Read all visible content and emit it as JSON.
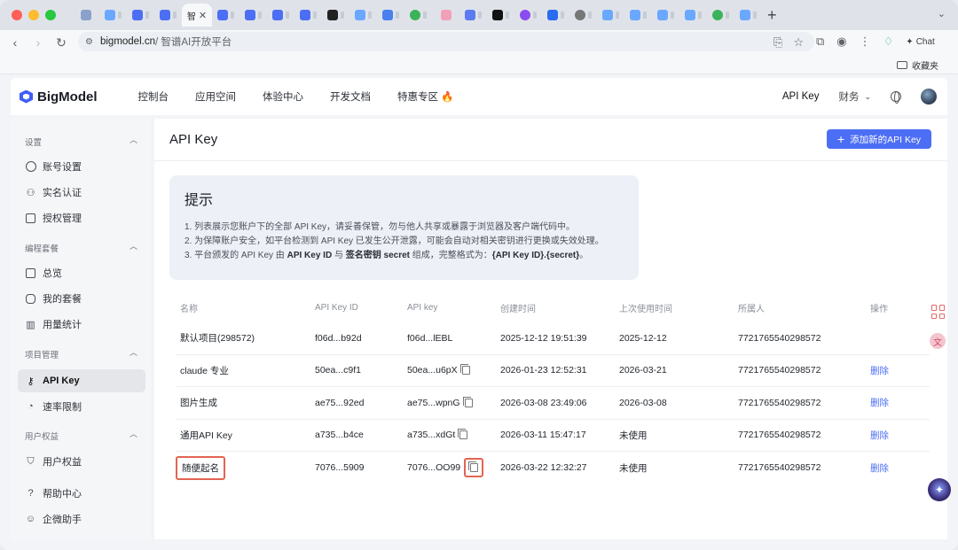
{
  "browser": {
    "active_tab_label": "智",
    "url_host": "bigmodel.cn",
    "url_rest": " / 智谱AI开放平台",
    "chat_label": "Chat",
    "bookmark_folder": "收藏夹"
  },
  "header": {
    "brand": "BigModel",
    "nav": [
      "控制台",
      "应用空间",
      "体验中心",
      "开发文档",
      "特惠专区 🔥"
    ],
    "api_key_link": "API Key",
    "finance_label": "财务"
  },
  "sidebar": {
    "sections": [
      {
        "title": "设置",
        "items": [
          "账号设置",
          "实名认证",
          "授权管理"
        ]
      },
      {
        "title": "编程套餐",
        "items": [
          "总览",
          "我的套餐",
          "用量统计"
        ]
      },
      {
        "title": "项目管理",
        "items": [
          "API Key",
          "速率限制"
        ]
      },
      {
        "title": "用户权益",
        "items": [
          "用户权益"
        ]
      }
    ],
    "footer_items": [
      "帮助中心",
      "企微助手"
    ]
  },
  "content": {
    "title": "API Key",
    "add_button": "添加新的API Key",
    "tip": {
      "title": "提示",
      "line1": "1. 列表展示您账户下的全部 API Key，请妥善保管，勿与他人共享或暴露于浏览器及客户端代码中。",
      "line2": "2. 为保障账户安全，如平台检测到 API Key 已发生公开泄露，可能会自动对相关密钥进行更换或失效处理。",
      "line3_a": "3. 平台颁发的 API Key 由 ",
      "line3_b": "API Key ID",
      "line3_c": " 与 ",
      "line3_d": "签名密钥 secret",
      "line3_e": " 组成，完整格式为：",
      "line3_f": "{API Key ID}.{secret}",
      "line3_g": "。"
    },
    "table": {
      "headers": [
        "名称",
        "API Key ID",
        "API key",
        "创建时间",
        "上次使用时间",
        "所属人",
        "操作"
      ],
      "rows": [
        {
          "name": "默认项目(298572)",
          "id": "f06d...b92d",
          "key": "f06d...lEBL",
          "created": "2025-12-12 19:51:39",
          "last_used": "2025-12-12",
          "owner": "7721765540298572",
          "action": ""
        },
        {
          "name": "claude 专业",
          "id": "50ea...c9f1",
          "key": "50ea...u6pX",
          "created": "2026-01-23 12:52:31",
          "last_used": "2026-03-21",
          "owner": "7721765540298572",
          "action": "删除"
        },
        {
          "name": "图片生成",
          "id": "ae75...92ed",
          "key": "ae75...wpnG",
          "created": "2026-03-08 23:49:06",
          "last_used": "2026-03-08",
          "owner": "7721765540298572",
          "action": "删除"
        },
        {
          "name": "通用API Key",
          "id": "a735...b4ce",
          "key": "a735...xdGt",
          "created": "2026-03-11 15:47:17",
          "last_used": "未使用",
          "owner": "7721765540298572",
          "action": "删除"
        },
        {
          "name": "随便起名",
          "id": "7076...5909",
          "key": "7076...OO99",
          "created": "2026-03-22 12:32:27",
          "last_used": "未使用",
          "owner": "7721765540298572",
          "action": "删除"
        }
      ]
    }
  },
  "floating": {
    "translate_glyph": "文"
  }
}
